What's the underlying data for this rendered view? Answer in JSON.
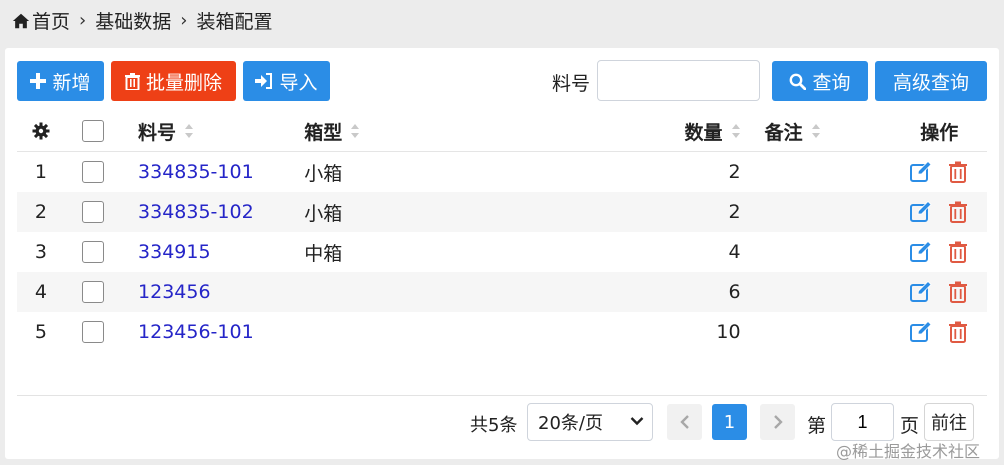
{
  "breadcrumb": {
    "items": [
      "首页",
      "基础数据",
      "装箱配置"
    ]
  },
  "toolbar": {
    "add_label": "新增",
    "batch_delete_label": "批量删除",
    "import_label": "导入",
    "search_label": "料号",
    "search_value": "",
    "query_label": "查询",
    "advanced_query_label": "高级查询"
  },
  "table": {
    "headers": {
      "code": "料号",
      "type": "箱型",
      "qty": "数量",
      "note": "备注",
      "ops": "操作"
    },
    "rows": [
      {
        "index": "1",
        "code": "334835-101",
        "type": "小箱",
        "qty": "2",
        "note": ""
      },
      {
        "index": "2",
        "code": "334835-102",
        "type": "小箱",
        "qty": "2",
        "note": ""
      },
      {
        "index": "3",
        "code": "334915",
        "type": "中箱",
        "qty": "4",
        "note": ""
      },
      {
        "index": "4",
        "code": "123456",
        "type": "",
        "qty": "6",
        "note": ""
      },
      {
        "index": "5",
        "code": "123456-101",
        "type": "",
        "qty": "10",
        "note": ""
      }
    ]
  },
  "pagination": {
    "total_text": "共5条",
    "page_size": "20条/页",
    "current_page": "1",
    "goto_prefix": "第",
    "goto_value": "1",
    "goto_suffix": "页",
    "goto_button": "前往"
  },
  "watermark": "@稀土掘金技术社区",
  "colors": {
    "primary": "#2b8de6",
    "danger": "#ee4016",
    "link": "#2525c8",
    "delete_icon": "#e05a43"
  }
}
